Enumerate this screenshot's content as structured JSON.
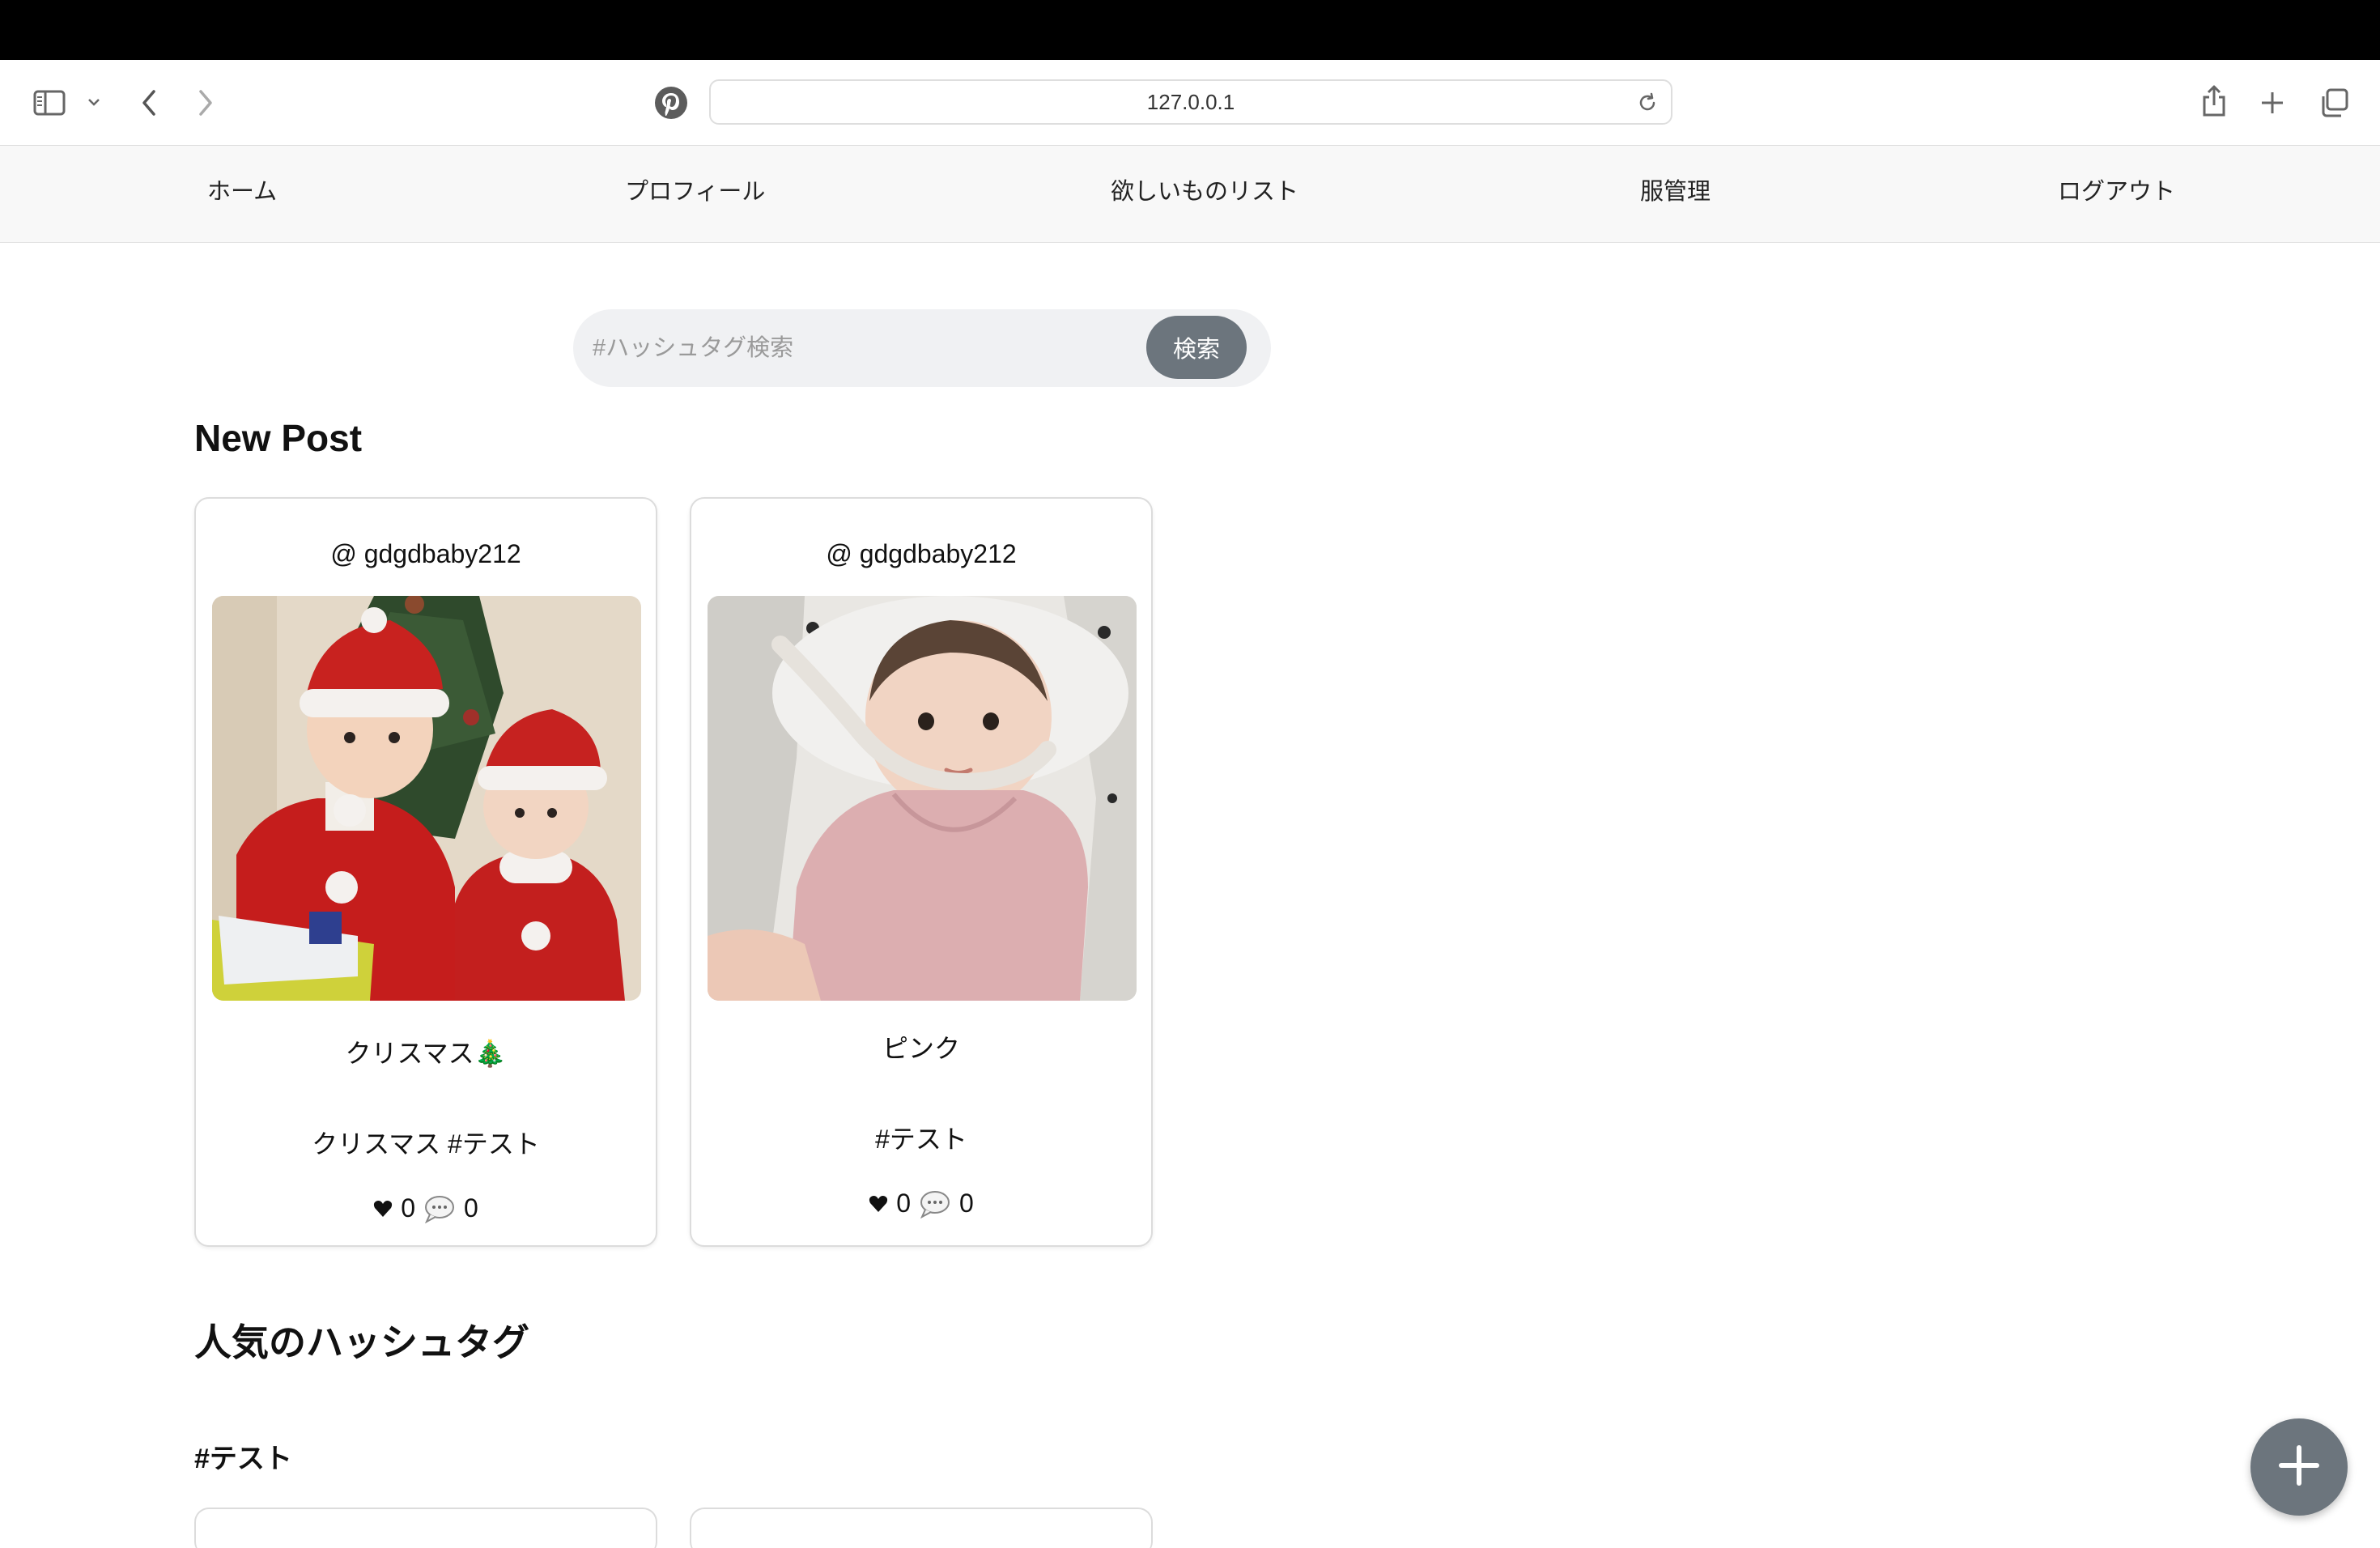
{
  "browser": {
    "url": "127.0.0.1"
  },
  "nav": {
    "items": [
      {
        "label": "ホーム"
      },
      {
        "label": "プロフィール"
      },
      {
        "label": "欲しいものリスト"
      },
      {
        "label": "服管理"
      },
      {
        "label": "ログアウト"
      }
    ]
  },
  "search": {
    "placeholder": "#ハッシュタグ検索",
    "button_label": "検索"
  },
  "new_post": {
    "heading": "New Post",
    "posts": [
      {
        "user": "@ gdgdbaby212",
        "title": "クリスマス🎄",
        "tags": "クリスマス #テスト",
        "likes": "0",
        "comments": "0"
      },
      {
        "user": "@ gdgdbaby212",
        "title": "ピンク",
        "tags": "#テスト",
        "likes": "0",
        "comments": "0"
      }
    ]
  },
  "popular": {
    "heading": "人気のハッシュタグ",
    "tag": "#テスト"
  },
  "icons": {
    "sidebar": "sidebar-icon",
    "back": "chevron-left-icon",
    "forward": "chevron-right-icon",
    "site": "pinterest-icon",
    "share": "share-icon",
    "new_tab": "plus-icon",
    "tabs": "tabs-icon",
    "like": "heart-icon",
    "comment": "comment-icon",
    "fab": "plus-icon"
  },
  "colors": {
    "accent_button": "#6c757d",
    "nav_background": "#f8f8f8"
  }
}
